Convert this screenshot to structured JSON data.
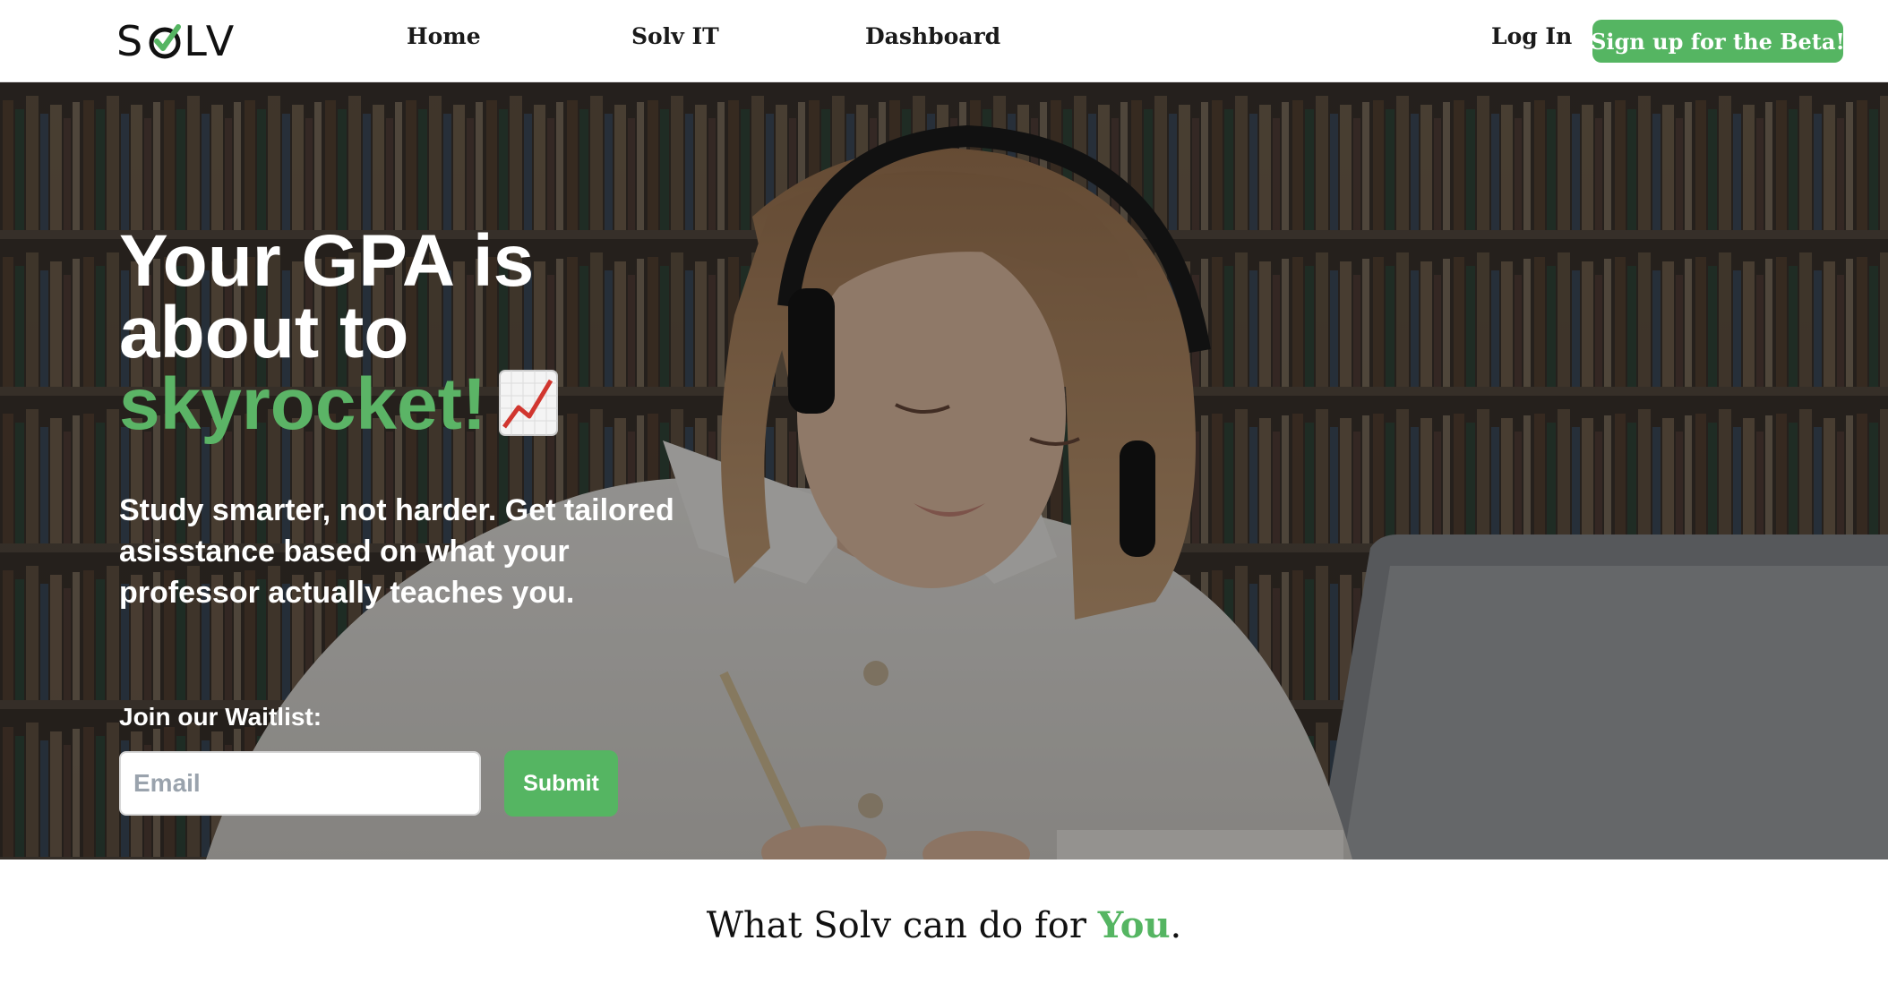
{
  "nav": {
    "logo_text_left": "S",
    "logo_text_right": "LV",
    "links": [
      "Home",
      "Solv IT",
      "Dashboard"
    ],
    "login_label": "Log In",
    "beta_label": "Sign up for the Beta!"
  },
  "hero": {
    "title_line1": "Your GPA is",
    "title_line2": "about to",
    "title_accent": "skyrocket!",
    "title_icon": "chart-increasing-icon",
    "subtitle": "Study smarter, not harder. Get tailored asisstance based on what your professor actually teaches you.",
    "waitlist_label": "Join our Waitlist:",
    "email_placeholder": "Email",
    "submit_label": "Submit"
  },
  "features": {
    "heading_prefix": "What Solv can do for ",
    "heading_accent": "You",
    "heading_suffix": "."
  },
  "colors": {
    "accent": "#55b562",
    "text_dark": "#111111",
    "hero_text": "#ffffff"
  }
}
